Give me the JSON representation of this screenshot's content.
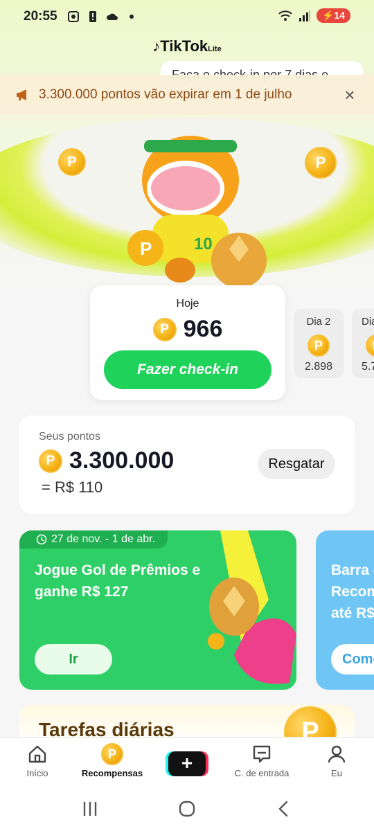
{
  "status_bar": {
    "time": "20:55",
    "battery": "14"
  },
  "app": {
    "logo": "TikTok",
    "logo_suffix": "Lite"
  },
  "tooltip": {
    "text": "Faça o check-in por 7 dias e"
  },
  "notice": {
    "text": "3.300.000 pontos vão expirar em 1 de julho"
  },
  "checkin": {
    "day_label": "Hoje",
    "points": "966",
    "button_label": "Fazer check-in",
    "upcoming": [
      {
        "label": "Dia 2",
        "value": "2.898"
      },
      {
        "label": "Dia",
        "value": "5.7"
      }
    ]
  },
  "balance": {
    "label": "Seus pontos",
    "points": "3.300.000",
    "conversion": "= R$ 110",
    "redeem_label": "Resgatar"
  },
  "promos": [
    {
      "date": "27 de nov. - 1 de abr.",
      "title": "Jogue Gol de Prêmios e ganhe R$ 127",
      "button": "Ir"
    },
    {
      "title_lines": [
        "Barra c",
        "Recom",
        "até  R$"
      ],
      "button": "Come"
    }
  ],
  "tasks": {
    "title": "Tarefas diárias"
  },
  "coin_symbol": "P",
  "bottom_nav": [
    {
      "label": "Início"
    },
    {
      "label": "Recompensas"
    },
    {
      "label": "+"
    },
    {
      "label": "C. de entrada"
    },
    {
      "label": "Eu"
    }
  ],
  "colors": {
    "accent_green": "#1fd35a",
    "promo_green": "#2fcf67",
    "promo_blue": "#6fc6f5",
    "notice_text": "#8a4a14"
  }
}
